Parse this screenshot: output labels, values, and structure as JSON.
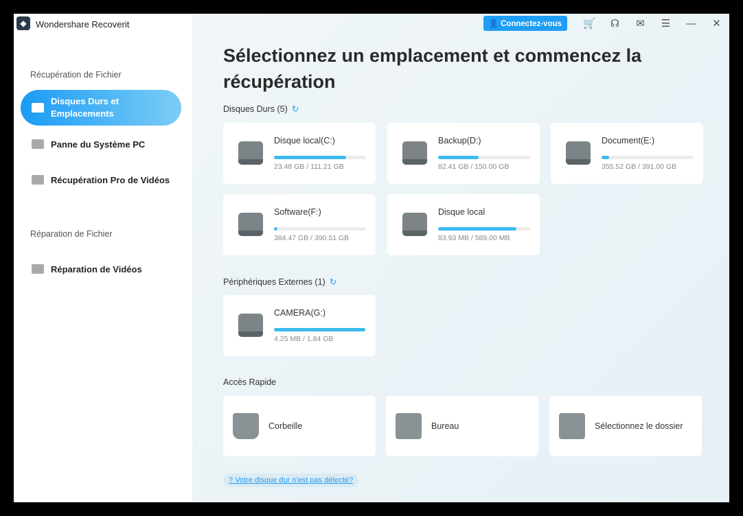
{
  "app": {
    "title": "Wondershare Recoverit"
  },
  "sidebar": {
    "section1": "Récupération de Fichier",
    "items": [
      {
        "label": "Disques Durs et Emplacements"
      },
      {
        "label": "Panne du Système PC"
      },
      {
        "label": "Récupération Pro de Vidéos"
      }
    ],
    "section2": "Réparation de Fichier",
    "repair_items": [
      {
        "label": "Réparation de Vidéos"
      }
    ]
  },
  "topbar": {
    "login": "Connectez-vous"
  },
  "main": {
    "title": "Sélectionnez un emplacement et commencez la récupération",
    "hard_drives_label": "Disques Durs (5)",
    "drives": [
      {
        "name": "Disque local(C:)",
        "size": "23.48 GB / 111.21 GB",
        "usage": 0.78
      },
      {
        "name": "Backup(D:)",
        "size": "82.41 GB / 150.00 GB",
        "usage": 0.44
      },
      {
        "name": "Document(E:)",
        "size": "355.52 GB / 391.00 GB",
        "usage": 0.08
      },
      {
        "name": "Software(F:)",
        "size": "384.47 GB / 390.51 GB",
        "usage": 0.04
      },
      {
        "name": "Disque local",
        "size": "83.93 MB / 589.00 MB",
        "usage": 0.85
      }
    ],
    "external_label": "Périphériques Externes (1)",
    "external": [
      {
        "name": "CAMERA(G:)",
        "size": "4.25 MB / 1.84 GB",
        "usage": 0.99
      }
    ],
    "quick_label": "Accès Rapide",
    "quick": [
      {
        "label": "Corbeille"
      },
      {
        "label": "Bureau"
      },
      {
        "label": "Sélectionnez le dossier"
      }
    ],
    "help": "Votre disque dur n'est pas détecté?"
  }
}
